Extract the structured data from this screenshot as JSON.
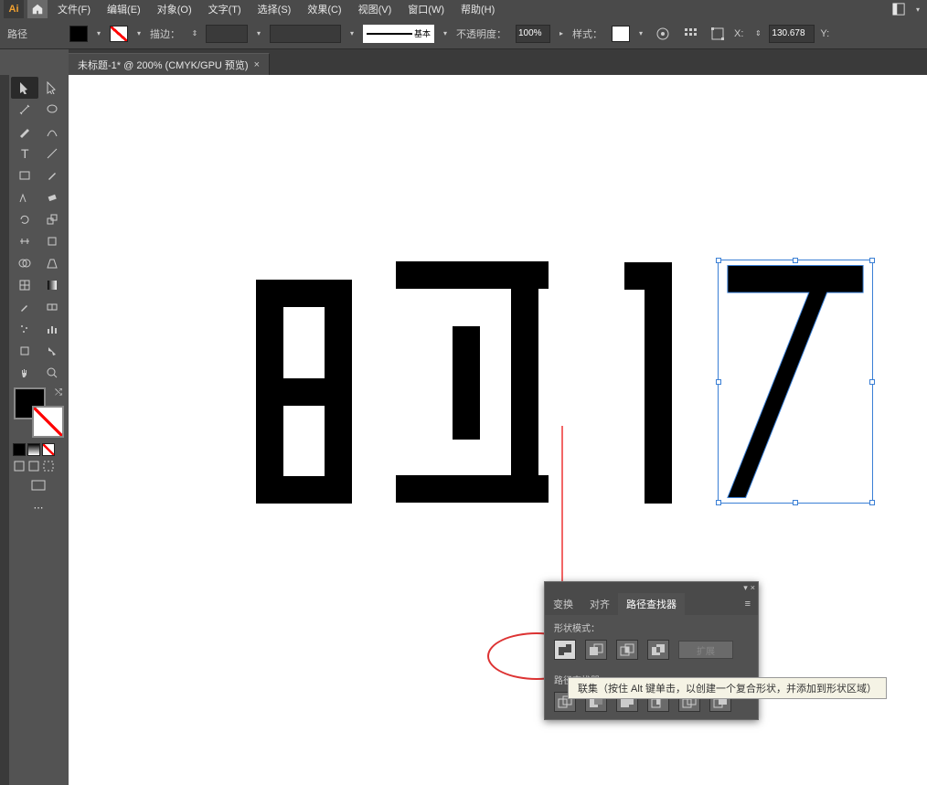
{
  "menu": {
    "file": "文件(F)",
    "edit": "编辑(E)",
    "object": "对象(O)",
    "type": "文字(T)",
    "select": "选择(S)",
    "effect": "效果(C)",
    "view": "视图(V)",
    "window": "窗口(W)",
    "help": "帮助(H)"
  },
  "optionbar": {
    "selection_label": "路径",
    "stroke_label": "描边：",
    "stroke_preset": "基本",
    "opacity_label": "不透明度：",
    "opacity_value": "100%",
    "style_label": "样式：",
    "x_label": "X:",
    "y_label": "Y:",
    "x_value": "130.678"
  },
  "document": {
    "tab_title": "未标题-1* @ 200% (CMYK/GPU 预览)"
  },
  "pathfinder": {
    "tab_transform": "变换",
    "tab_align": "对齐",
    "tab_pathfinder": "路径查找器",
    "shape_modes_label": "形状模式：",
    "pathfinders_label": "路径查找器：",
    "expand_label": "扩展"
  },
  "tooltip": {
    "text": "联集（按住 Alt 键单击，以创建一个复合形状，并添加到形状区域）"
  }
}
